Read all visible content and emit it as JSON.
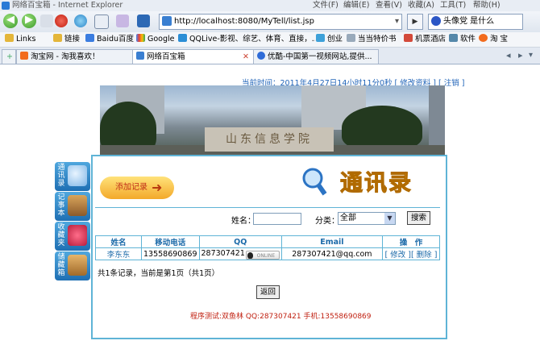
{
  "window": {
    "title": "网络百宝箱 - Internet Explorer"
  },
  "menus": [
    "文件(F)",
    "编辑(E)",
    "查看(V)",
    "收藏(A)",
    "工具(T)",
    "帮助(H)"
  ],
  "address": {
    "url": "http://localhost:8080/MyTell/list.jsp",
    "go_label": "▶"
  },
  "search": {
    "value": "头像党 是什么"
  },
  "favorites": [
    "Links",
    "链接",
    "Baidu百度",
    "Google",
    "QQLive-影视、综艺、体育、直接，...",
    "创业",
    "当当特价书",
    "机票酒店",
    "软件",
    "淘 宝"
  ],
  "tabs": [
    {
      "label": "淘宝网 - 淘我喜欢！",
      "active": false
    },
    {
      "label": "网络百宝箱",
      "active": true
    },
    {
      "label": "优酷-中国第一视频网站,提供...",
      "active": false
    }
  ],
  "page": {
    "top_info": "当前时间：2011年4月27日14小时11分0秒 [ 修改资料 ]  [ 注销 ]",
    "banner_sign": "山东信息学院",
    "add_record": "添加记录",
    "logo_text": "通讯录",
    "sidebar": [
      {
        "label": "通讯录",
        "icon": "address-book-icon"
      },
      {
        "label": "记事本",
        "icon": "notebook-icon"
      },
      {
        "label": "收藏夹",
        "icon": "favorites-icon"
      },
      {
        "label": "储藏箱",
        "icon": "storage-box-icon"
      }
    ],
    "filter": {
      "name_label": "姓名：",
      "name_value": "",
      "category_label": "分类：",
      "category_value": "全部",
      "search_label": "搜索"
    },
    "table": {
      "headers": [
        "姓名",
        "移动电话",
        "QQ",
        "Email",
        "操　作"
      ],
      "rows": [
        {
          "name": "李东东",
          "mobile": "13558690869",
          "qq": "287307421",
          "qq_status": "ONLINE",
          "email": "287307421@qq.com",
          "edit": "[ 修改 ]",
          "delete": "[ 删除 ]"
        }
      ]
    },
    "summary": "共1条记录，当前是第1页（共1页）",
    "back_label": "返回",
    "footer": "程序测试:双鱼林 QQ:287307421 手机:13558690869"
  },
  "colors": {
    "accent": "#5fb4d6",
    "link": "#1b6aa9",
    "footer": "#c02010",
    "logo": "#f6a21a"
  }
}
